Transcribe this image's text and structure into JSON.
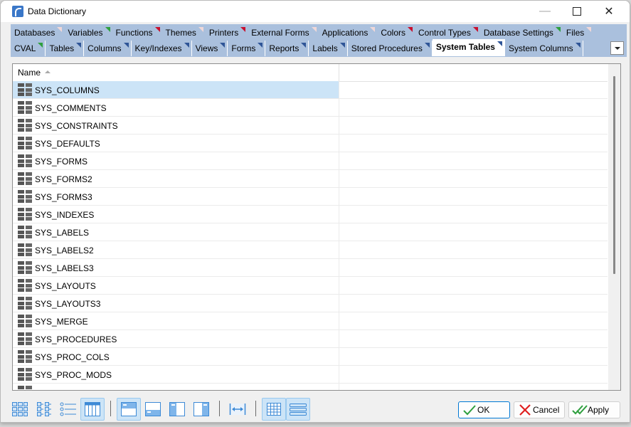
{
  "window": {
    "title": "Data Dictionary",
    "controls": {
      "minimize": "—",
      "maximize": "□",
      "close": "✕"
    }
  },
  "tabs": {
    "row1": [
      {
        "label": "Databases",
        "marker": "pink"
      },
      {
        "label": "Variables",
        "marker": "green"
      },
      {
        "label": "Functions",
        "marker": "red"
      },
      {
        "label": "Themes",
        "marker": "pink"
      },
      {
        "label": "Printers",
        "marker": "red"
      },
      {
        "label": "External Forms",
        "marker": "pink"
      },
      {
        "label": "Applications",
        "marker": "pink"
      },
      {
        "label": "Colors",
        "marker": "red"
      },
      {
        "label": "Control Types",
        "marker": "red"
      },
      {
        "label": "Database Settings",
        "marker": "green"
      },
      {
        "label": "Files",
        "marker": "pink"
      }
    ],
    "row2": [
      {
        "label": "CVAL",
        "marker": "green"
      },
      {
        "label": "Tables",
        "marker": "blue"
      },
      {
        "label": "Columns",
        "marker": "blue"
      },
      {
        "label": "Key/Indexes",
        "marker": "blue"
      },
      {
        "label": "Views",
        "marker": "blue"
      },
      {
        "label": "Forms",
        "marker": "blue"
      },
      {
        "label": "Reports",
        "marker": "blue"
      },
      {
        "label": "Labels",
        "marker": "blue"
      },
      {
        "label": "Stored Procedures",
        "marker": "blue"
      },
      {
        "label": "System Tables",
        "marker": "blue",
        "active": true
      },
      {
        "label": "System Columns",
        "marker": "blue"
      }
    ],
    "marker_colors": {
      "red": "#c8102e",
      "green": "#2e9f3e",
      "blue": "#2f5597",
      "pink": "#f0d8d8"
    }
  },
  "grid": {
    "columns": [
      {
        "label": "Name",
        "sort": "ascending"
      }
    ],
    "rows": [
      {
        "name": "SYS_COLUMNS",
        "selected": true
      },
      {
        "name": "SYS_COMMENTS"
      },
      {
        "name": "SYS_CONSTRAINTS"
      },
      {
        "name": "SYS_DEFAULTS"
      },
      {
        "name": "SYS_FORMS"
      },
      {
        "name": "SYS_FORMS2"
      },
      {
        "name": "SYS_FORMS3"
      },
      {
        "name": "SYS_INDEXES"
      },
      {
        "name": "SYS_LABELS"
      },
      {
        "name": "SYS_LABELS2"
      },
      {
        "name": "SYS_LABELS3"
      },
      {
        "name": "SYS_LAYOUTS"
      },
      {
        "name": "SYS_LAYOUTS3"
      },
      {
        "name": "SYS_MERGE"
      },
      {
        "name": "SYS_PROCEDURES"
      },
      {
        "name": "SYS_PROC_COLS"
      },
      {
        "name": "SYS_PROC_MODS"
      },
      {
        "name": ""
      }
    ]
  },
  "toolbar": {
    "view_buttons": [
      {
        "name": "large-icons-view",
        "active": false
      },
      {
        "name": "small-icons-view",
        "active": false
      },
      {
        "name": "list-view",
        "active": false
      },
      {
        "name": "details-view",
        "active": true
      }
    ],
    "panel_buttons": [
      {
        "name": "panel-top",
        "active": true
      },
      {
        "name": "panel-bottom",
        "active": false
      },
      {
        "name": "panel-left",
        "active": false
      },
      {
        "name": "panel-right",
        "active": false
      }
    ],
    "fit_columns": {
      "name": "fit-columns",
      "active": false
    },
    "grid_buttons": [
      {
        "name": "grid-lines",
        "active": true
      },
      {
        "name": "row-lines",
        "active": true
      }
    ]
  },
  "buttons": {
    "ok": "OK",
    "cancel": "Cancel",
    "apply": "Apply"
  }
}
